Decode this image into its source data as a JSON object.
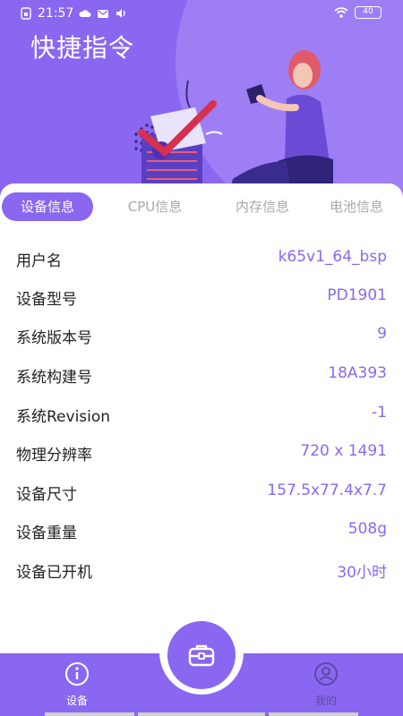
{
  "status_bar": {
    "time": "21:57",
    "battery": "40",
    "icons": [
      "sim-icon",
      "cloud-icon",
      "mail-icon",
      "volume-icon",
      "wifi-icon",
      "battery-icon"
    ]
  },
  "header": {
    "title": "快捷指令"
  },
  "tabs": [
    {
      "label": "设备信息",
      "active": true
    },
    {
      "label": "CPU信息",
      "active": false
    },
    {
      "label": "内存信息",
      "active": false
    },
    {
      "label": "电池信息",
      "active": false
    }
  ],
  "device_info": [
    {
      "label": "用户名",
      "value": "k65v1_64_bsp"
    },
    {
      "label": "设备型号",
      "value": "PD1901"
    },
    {
      "label": "系统版本号",
      "value": "9"
    },
    {
      "label": "系统构建号",
      "value": "18A393"
    },
    {
      "label": "系统Revision",
      "value": "-1"
    },
    {
      "label": "物理分辨率",
      "value": "720 x 1491"
    },
    {
      "label": "设备尺寸",
      "value": "157.5x77.4x7.7"
    },
    {
      "label": "设备重量",
      "value": "508g"
    },
    {
      "label": "设备已开机",
      "value": "30小时"
    }
  ],
  "bottom_nav": {
    "device_label": "设备",
    "mine_label": "我的",
    "fab_icon": "briefcase-icon"
  },
  "colors": {
    "accent": "#8a67f0",
    "value_text": "#8a67f0",
    "tab_inactive": "#a8a8a8"
  }
}
